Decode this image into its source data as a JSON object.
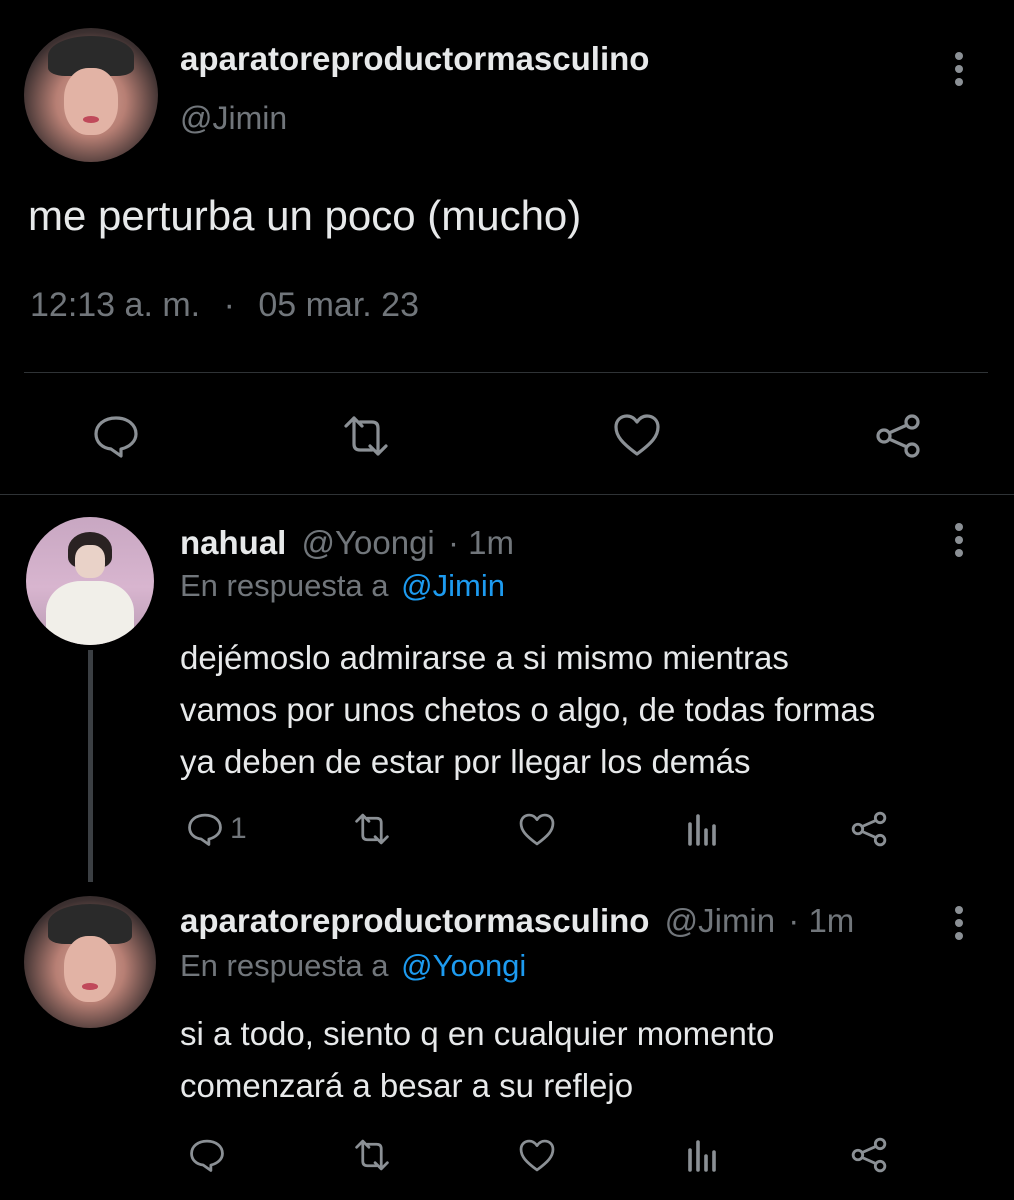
{
  "main_tweet": {
    "display_name": "aparatoreproductormasculino",
    "handle": "@Jimin",
    "text": "me perturba un poco (mucho)",
    "time": "12:13 a. m.",
    "separator": "·",
    "date": "05 mar. 23"
  },
  "replies": [
    {
      "display_name": "nahual",
      "handle": "@Yoongi",
      "age": "· 1m",
      "reply_to_prefix": "En respuesta a",
      "reply_to": "@Jimin",
      "text_lines": [
        "dejémoslo admirarse a si mismo mientras",
        "vamos por unos chetos o algo, de todas formas",
        "ya deben de estar por llegar los demás"
      ],
      "reply_count": "1"
    },
    {
      "display_name": "aparatoreproductormasculino",
      "handle": "@Jimin",
      "age": "· 1m",
      "reply_to_prefix": "En respuesta a",
      "reply_to": "@Yoongi",
      "text_lines": [
        "si a todo, siento q en cualquier momento",
        "comenzará a besar a su reflejo"
      ]
    }
  ],
  "colors": {
    "background": "#000000",
    "text": "#e7e9ea",
    "muted": "#71767b",
    "link": "#1d9bf0",
    "divider": "#2f3336"
  },
  "icons": [
    "reply-icon",
    "retweet-icon",
    "like-icon",
    "analytics-icon",
    "share-icon",
    "more-icon"
  ]
}
